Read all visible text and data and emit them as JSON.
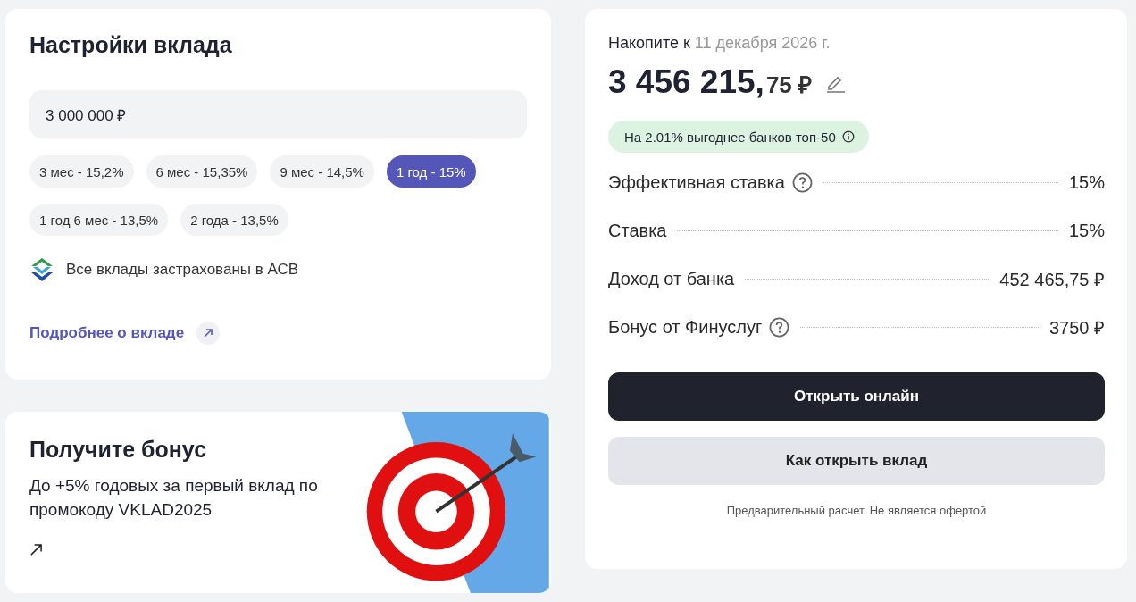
{
  "settings": {
    "title": "Настройки вклада",
    "amount": "3 000 000 ₽",
    "terms": [
      {
        "label": "3 мес - 15,2%",
        "selected": false
      },
      {
        "label": "6 мес - 15,35%",
        "selected": false
      },
      {
        "label": "9 мес - 14,5%",
        "selected": false
      },
      {
        "label": "1 год - 15%",
        "selected": true
      },
      {
        "label": "1 год 6 мес - 13,5%",
        "selected": false
      },
      {
        "label": "2 года - 13,5%",
        "selected": false
      }
    ],
    "insurance": "Все вклады застрахованы в АСВ",
    "more_link": "Подробнее о вкладе"
  },
  "bonus": {
    "title": "Получите бонус",
    "text": "До +5% годовых за первый вклад по промокоду VKLAD2025"
  },
  "summary": {
    "label": "Накопите к",
    "date": "11 декабря 2026 г.",
    "amount_main": "3 456 215,",
    "amount_fraction": "75 ₽",
    "badge": "На 2.01% выгоднее банков топ-50",
    "rows": [
      {
        "label": "Эффективная ставка",
        "help": true,
        "value": "15%"
      },
      {
        "label": "Ставка",
        "help": false,
        "value": "15%"
      },
      {
        "label": "Доход от банка",
        "help": false,
        "value": "452 465,75 ₽"
      },
      {
        "label": "Бонус от Финуслуг",
        "help": true,
        "value": "3750 ₽"
      }
    ],
    "primary_button": "Открыть онлайн",
    "secondary_button": "Как открыть вклад",
    "disclaimer": "Предварительный расчет. Не является офертой"
  }
}
